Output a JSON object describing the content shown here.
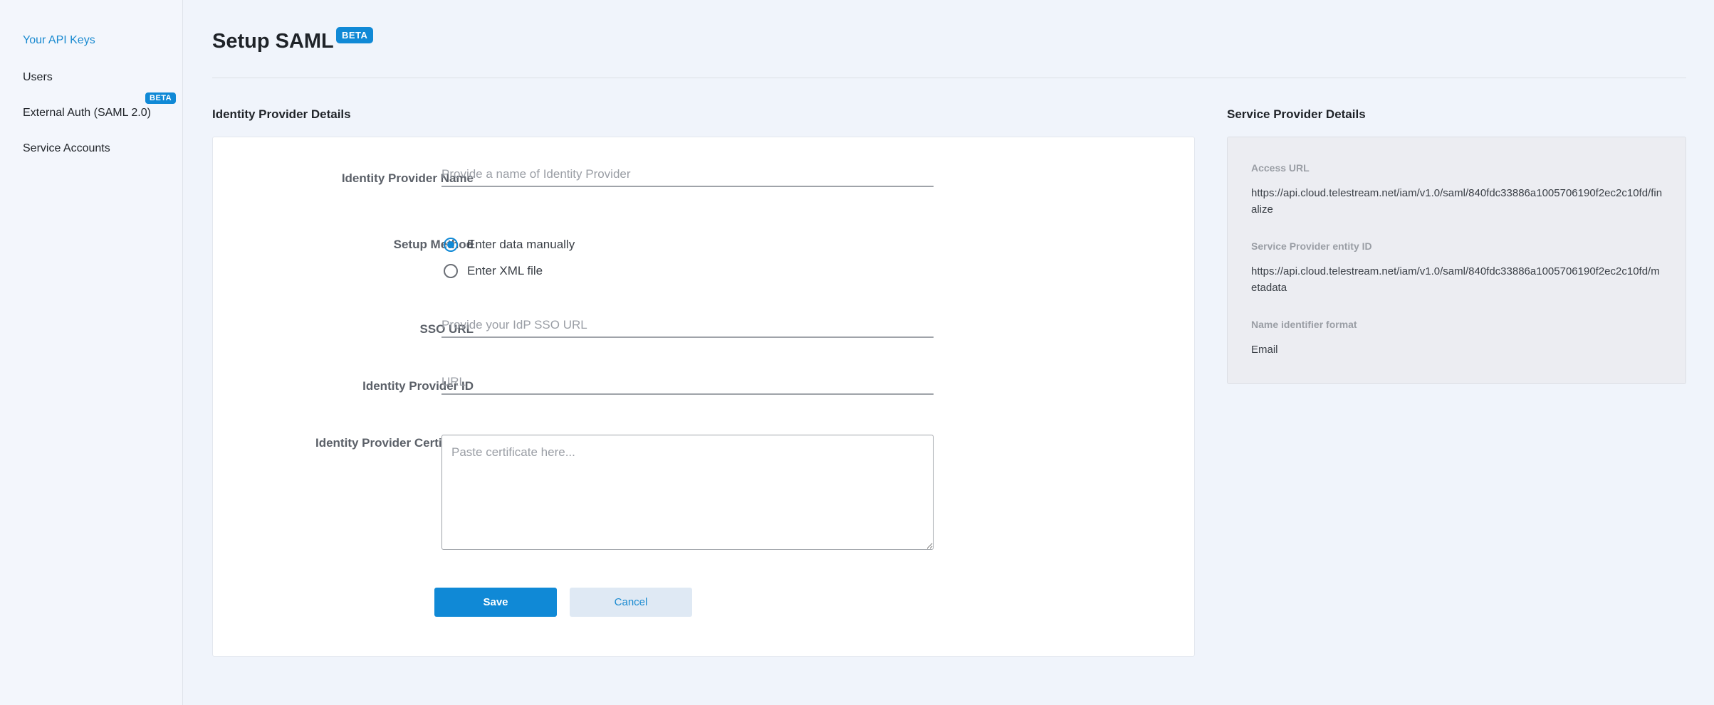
{
  "sidebar": {
    "items": [
      {
        "label": "Your API Keys",
        "active": true
      },
      {
        "label": "Users"
      },
      {
        "label": "External Auth (SAML 2.0)",
        "badge": "BETA"
      },
      {
        "label": "Service Accounts"
      }
    ]
  },
  "header": {
    "title": "Setup SAML",
    "badge": "BETA"
  },
  "idp": {
    "section_title": "Identity Provider Details",
    "name_label": "Identity Provider Name",
    "name_placeholder": "Provide a name of Identity Provider",
    "name_value": "",
    "method_label": "Setup Method",
    "method_options": [
      {
        "label": "Enter data manually",
        "selected": true
      },
      {
        "label": "Enter XML file",
        "selected": false
      }
    ],
    "sso_label": "SSO URL",
    "sso_placeholder": "Provide your IdP SSO URL",
    "sso_value": "",
    "id_label": "Identity Provider ID",
    "id_placeholder": "URL",
    "id_value": "",
    "cert_label": "Identity Provider Certificate",
    "cert_placeholder": "Paste certificate here...",
    "cert_value": "",
    "save_label": "Save",
    "cancel_label": "Cancel"
  },
  "sp": {
    "section_title": "Service Provider Details",
    "access_url_label": "Access URL",
    "access_url": "https://api.cloud.telestream.net/iam/v1.0/saml/840fdc33886a1005706190f2ec2c10fd/finalize",
    "entity_id_label": "Service Provider entity ID",
    "entity_id": "https://api.cloud.telestream.net/iam/v1.0/saml/840fdc33886a1005706190f2ec2c10fd/metadata",
    "name_format_label": "Name identifier format",
    "name_format": "Email"
  },
  "colors": {
    "accent": "#1089d6",
    "background": "#f0f4fb",
    "card": "#ffffff",
    "sp_card": "#ecedf2"
  }
}
